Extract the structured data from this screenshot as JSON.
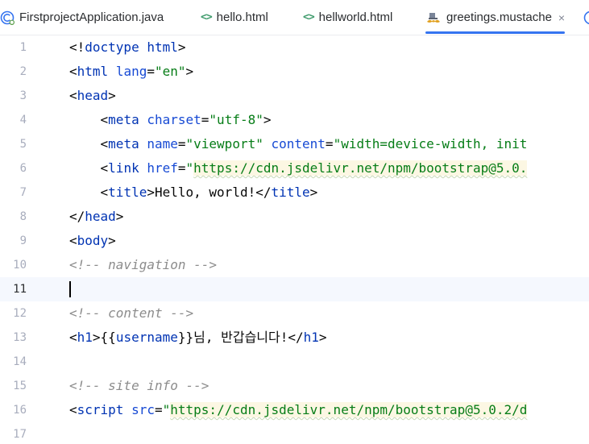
{
  "tabs": [
    {
      "label": "FirstprojectApplication.java",
      "icon": "spring-class-icon",
      "active": false
    },
    {
      "label": "hello.html",
      "icon": "html-file-icon",
      "active": false
    },
    {
      "label": "hellworld.html",
      "icon": "html-file-icon",
      "active": false
    },
    {
      "label": "greetings.mustache",
      "icon": "mustache-file-icon",
      "active": true,
      "close": "×"
    }
  ],
  "colors": {
    "accent": "#3574f0",
    "tag": "#0033b3",
    "attribute": "#174ad4",
    "string": "#067d17",
    "comment": "#8c8c8c",
    "line_number": "#a8adbd",
    "current_line": "#f5f8fe",
    "url_highlight": "#fcf7e3"
  },
  "editor": {
    "current_line": 11,
    "lines": [
      {
        "n": "1",
        "tokens": [
          [
            "punct",
            "<!"
          ],
          [
            "tag",
            "doctype"
          ],
          [
            "punct",
            " "
          ],
          [
            "tag",
            "html"
          ],
          [
            "punct",
            ">"
          ]
        ]
      },
      {
        "n": "2",
        "tokens": [
          [
            "punct",
            "<"
          ],
          [
            "tag",
            "html"
          ],
          [
            "punct",
            " "
          ],
          [
            "attr",
            "lang"
          ],
          [
            "punct",
            "="
          ],
          [
            "str",
            "\"en\""
          ],
          [
            "punct",
            ">"
          ]
        ]
      },
      {
        "n": "3",
        "tokens": [
          [
            "punct",
            "<"
          ],
          [
            "tag",
            "head"
          ],
          [
            "punct",
            ">"
          ]
        ]
      },
      {
        "n": "4",
        "tokens": [
          [
            "punct",
            "    <"
          ],
          [
            "tag",
            "meta"
          ],
          [
            "punct",
            " "
          ],
          [
            "attr",
            "charset"
          ],
          [
            "punct",
            "="
          ],
          [
            "str",
            "\"utf-8\""
          ],
          [
            "punct",
            ">"
          ]
        ]
      },
      {
        "n": "5",
        "tokens": [
          [
            "punct",
            "    <"
          ],
          [
            "tag",
            "meta"
          ],
          [
            "punct",
            " "
          ],
          [
            "attr",
            "name"
          ],
          [
            "punct",
            "="
          ],
          [
            "str",
            "\"viewport\""
          ],
          [
            "punct",
            " "
          ],
          [
            "attr",
            "content"
          ],
          [
            "punct",
            "="
          ],
          [
            "str",
            "\"width=device-width, init"
          ]
        ]
      },
      {
        "n": "6",
        "tokens": [
          [
            "punct",
            "    <"
          ],
          [
            "tag",
            "link"
          ],
          [
            "punct",
            " "
          ],
          [
            "attr",
            "href"
          ],
          [
            "punct",
            "="
          ],
          [
            "str",
            "\""
          ],
          [
            "url",
            "https://cdn.jsdelivr.net/npm/bootstrap@5.0."
          ]
        ]
      },
      {
        "n": "7",
        "tokens": [
          [
            "punct",
            "    <"
          ],
          [
            "tag",
            "title"
          ],
          [
            "punct",
            ">"
          ],
          [
            "text",
            "Hello, world!"
          ],
          [
            "punct",
            "</"
          ],
          [
            "tag",
            "title"
          ],
          [
            "punct",
            ">"
          ]
        ]
      },
      {
        "n": "8",
        "tokens": [
          [
            "punct",
            "</"
          ],
          [
            "tag",
            "head"
          ],
          [
            "punct",
            ">"
          ]
        ]
      },
      {
        "n": "9",
        "tokens": [
          [
            "punct",
            "<"
          ],
          [
            "tag",
            "body"
          ],
          [
            "punct",
            ">"
          ]
        ]
      },
      {
        "n": "10",
        "tokens": [
          [
            "comment",
            "<!-- navigation -->"
          ]
        ]
      },
      {
        "n": "11",
        "tokens": []
      },
      {
        "n": "12",
        "tokens": [
          [
            "comment",
            "<!-- content -->"
          ]
        ]
      },
      {
        "n": "13",
        "tokens": [
          [
            "punct",
            "<"
          ],
          [
            "tag",
            "h1"
          ],
          [
            "punct",
            ">{{"
          ],
          [
            "var",
            "username"
          ],
          [
            "punct",
            "}}"
          ],
          [
            "text",
            "님, 반갑습니다!"
          ],
          [
            "punct",
            "</"
          ],
          [
            "tag",
            "h1"
          ],
          [
            "punct",
            ">"
          ]
        ]
      },
      {
        "n": "14",
        "tokens": []
      },
      {
        "n": "15",
        "tokens": [
          [
            "comment",
            "<!-- site info -->"
          ]
        ]
      },
      {
        "n": "16",
        "tokens": [
          [
            "punct",
            "<"
          ],
          [
            "tag",
            "script"
          ],
          [
            "punct",
            " "
          ],
          [
            "attr",
            "src"
          ],
          [
            "punct",
            "="
          ],
          [
            "str",
            "\""
          ],
          [
            "url",
            "https://cdn.jsdelivr.net/npm/bootstrap@5.0.2/d"
          ]
        ]
      },
      {
        "n": "17",
        "tokens": []
      }
    ]
  }
}
